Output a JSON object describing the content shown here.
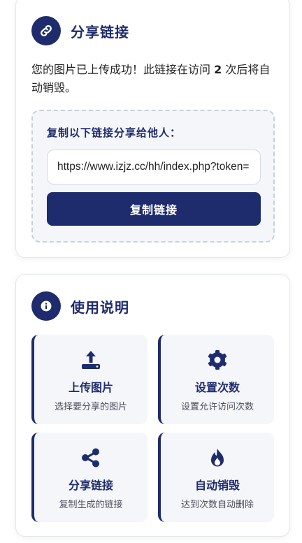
{
  "share_card": {
    "title": "分享链接",
    "icon": "link-icon",
    "message_before": "您的图片已上传成功！此链接在访问 ",
    "visit_count": "2",
    "message_after": " 次后将自动销毁。",
    "copy_label": "复制以下链接分享给他人：",
    "link_value": "https://www.izjz.cc/hh/index.php?token=",
    "copy_button": "复制链接"
  },
  "help_card": {
    "title": "使用说明",
    "icon": "info-icon",
    "features": [
      {
        "icon": "upload-icon",
        "title": "上传图片",
        "desc": "选择要分享的图片"
      },
      {
        "icon": "gear-icon",
        "title": "设置次数",
        "desc": "设置允许访问次数"
      },
      {
        "icon": "share-icon",
        "title": "分享链接",
        "desc": "复制生成的链接"
      },
      {
        "icon": "fire-icon",
        "title": "自动销毁",
        "desc": "达到次数自动删除"
      }
    ]
  },
  "colors": {
    "primary": "#1e2b6d",
    "panel": "#f4f6fa",
    "border": "#e3e6ee"
  }
}
